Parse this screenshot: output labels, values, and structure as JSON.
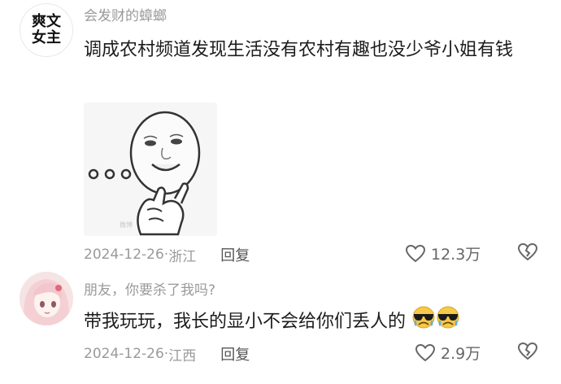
{
  "comments": [
    {
      "avatar_lines": [
        "爽文",
        "女主"
      ],
      "username": "会发财的蟑螂",
      "text": "调成农村频道发现生活没有农村有趣也没少爷小姐有钱",
      "sticker_watermark": "微博",
      "date": "2024-12-26",
      "location": "浙江",
      "reply_label": "回复",
      "like_count": "12.3万"
    },
    {
      "username": "朋友，你要杀了我吗?",
      "text": "带我玩玩，我长的显小不会给你们丢人的",
      "emoji": [
        "sunglasses-cry-emoji",
        "sunglasses-cry-emoji"
      ],
      "date": "2024-12-26",
      "location": "江西",
      "reply_label": "回复",
      "like_count": "2.9万"
    }
  ],
  "colors": {
    "meta": "#9a9a9a",
    "text": "#1c1c1c",
    "emoji_face": "#f7c948",
    "emoji_tear": "#5ab0f0"
  }
}
